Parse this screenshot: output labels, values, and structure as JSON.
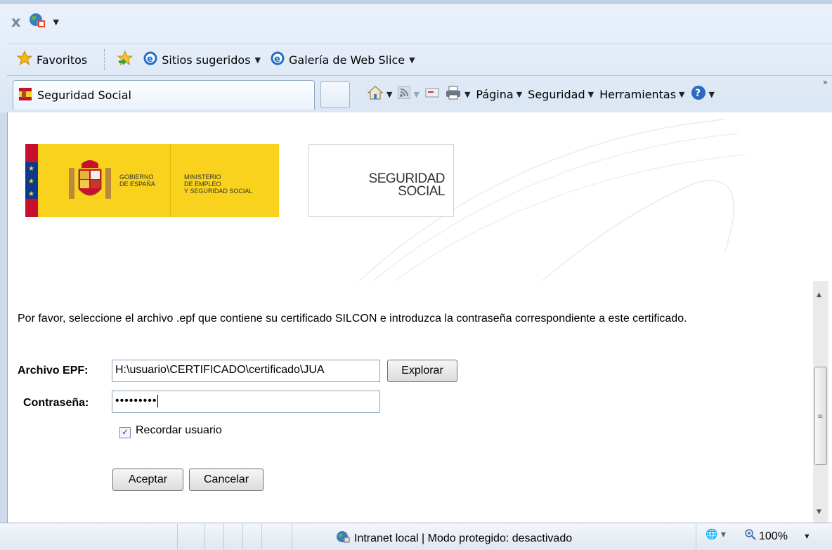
{
  "toolbar": {
    "favorites_label": "Favoritos",
    "suggested_sites_label": "Sitios sugeridos",
    "web_slice_gallery_label": "Galería de Web Slice"
  },
  "tab": {
    "title": "Seguridad Social"
  },
  "command_bar": {
    "page_label": "Página",
    "security_label": "Seguridad",
    "tools_label": "Herramientas"
  },
  "logos": {
    "gobierno_line1": "GOBIERNO",
    "gobierno_line2": "DE ESPAÑA",
    "ministerio_line1": "MINISTERIO",
    "ministerio_line2": "DE EMPLEO",
    "ministerio_line3": "Y SEGURIDAD SOCIAL",
    "ss_line1": "SEGURIDAD",
    "ss_line2": "SOCIAL"
  },
  "form": {
    "intro_text": "Por favor, seleccione el archivo .epf que contiene su certificado SILCON e introduzca la contraseña correspondiente a este certificado.",
    "epf_label": "Archivo EPF:",
    "epf_value": "H:\\usuario\\CERTIFICADO\\certificado\\JUA",
    "browse_label": "Explorar",
    "password_label": "Contraseña:",
    "password_value": "•••••••••",
    "remember_label": "Recordar usuario",
    "remember_checked": true,
    "accept_label": "Aceptar",
    "cancel_label": "Cancelar"
  },
  "status_bar": {
    "zone_text": "Intranet local | Modo protegido: desactivado",
    "zoom_text": "100%"
  },
  "colors": {
    "gov_yellow": "#f8d21c",
    "flag_red": "#c8102e",
    "flag_blue": "#0a3a8f",
    "chrome_blue": "#dbe6f4"
  }
}
